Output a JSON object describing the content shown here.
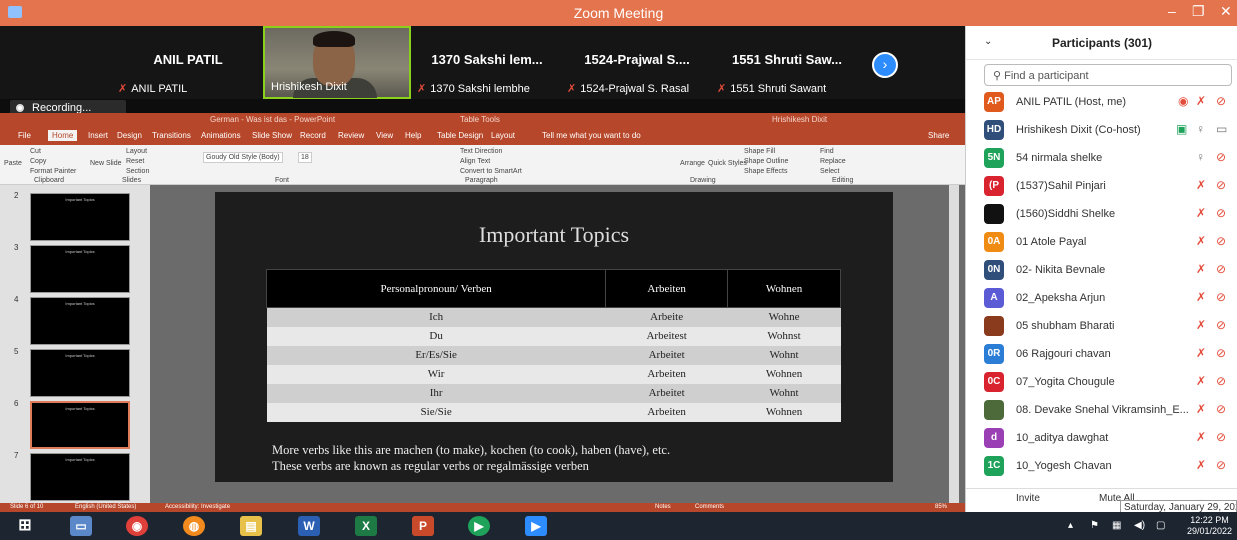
{
  "window": {
    "title": "Zoom Meeting",
    "minimize": "–",
    "maximize": "❐",
    "close": "✕"
  },
  "video_strip": [
    {
      "big": "ANIL PATIL",
      "small": "ANIL PATIL"
    },
    {
      "big": "",
      "small": "Hrishikesh Dixit"
    },
    {
      "big": "1370 Sakshi lem...",
      "small": "1370 Sakshi lembhe"
    },
    {
      "big": "1524-Prajwal S....",
      "small": "1524-Prajwal S. Rasal"
    },
    {
      "big": "1551 Shruti Saw...",
      "small": "1551 Shruti Sawant"
    }
  ],
  "recording": {
    "label": "Recording..."
  },
  "powerpoint": {
    "title": "German - Was ist das - PowerPoint",
    "table_tools": "Table Tools",
    "user": "Hrishikesh Dixit",
    "tabs": [
      "File",
      "Home",
      "Insert",
      "Design",
      "Transitions",
      "Animations",
      "Slide Show",
      "Record",
      "Review",
      "View",
      "Help",
      "Table Design",
      "Layout",
      "Tell me what you want to do",
      "Share"
    ],
    "ribbon": {
      "paste": "Paste",
      "cut": "Cut",
      "copy": "Copy",
      "format_painter": "Format Painter",
      "new_slide": "New Slide",
      "layout": "Layout",
      "reset": "Reset",
      "section": "Section",
      "font_name": "Goudy Old Style (Body)",
      "font_size": "18",
      "text_direction": "Text Direction",
      "align_text": "Align Text",
      "smartart": "Convert to SmartArt",
      "arrange": "Arrange",
      "quick_styles": "Quick Styles",
      "shape_fill": "Shape Fill",
      "shape_outline": "Shape Outline",
      "shape_effects": "Shape Effects",
      "find": "Find",
      "replace": "Replace",
      "select": "Select",
      "groups": [
        "Clipboard",
        "Slides",
        "Font",
        "Paragraph",
        "Drawing",
        "Editing"
      ]
    },
    "thumbnails": [
      {
        "num": "2",
        "title": "Important Topics"
      },
      {
        "num": "3",
        "title": "Important Topics"
      },
      {
        "num": "4",
        "title": "Important Topics"
      },
      {
        "num": "5",
        "title": "Important Topics"
      },
      {
        "num": "6",
        "title": "Important Topics"
      },
      {
        "num": "7",
        "title": "Important Topics"
      }
    ],
    "slide": {
      "title": "Important Topics",
      "headers": [
        "Personalpronoun/ Verben",
        "Arbeiten",
        "Wohnen"
      ],
      "rows": [
        [
          "Ich",
          "Arbeite",
          "Wohne"
        ],
        [
          "Du",
          "Arbeitest",
          "Wohnst"
        ],
        [
          "Er/Es/Sie",
          "Arbeitet",
          "Wohnt"
        ],
        [
          "Wir",
          "Arbeiten",
          "Wohnen"
        ],
        [
          "Ihr",
          "Arbeitet",
          "Wohnt"
        ],
        [
          "Sie/Sie",
          "Arbeiten",
          "Wohnen"
        ]
      ],
      "note_line1": "More verbs like this are machen (to make), kochen (to cook), haben (have), etc.",
      "note_line2": "These verbs are known as regular verbs or regalmässige verben"
    },
    "status": {
      "slide": "Slide 6 of 10",
      "language": "English (United States)",
      "accessibility": "Accessibility: Investigate",
      "notes": "Notes",
      "comments": "Comments",
      "zoom": "85%"
    }
  },
  "participants": {
    "header": "Participants (301)",
    "search_placeholder": "Find a participant",
    "list": [
      {
        "initials": "AP",
        "color": "#e05a1e",
        "name": "ANIL PATIL (Host, me)"
      },
      {
        "initials": "HD",
        "color": "#2f4e7a",
        "name": "Hrishikesh Dixit (Co-host)"
      },
      {
        "initials": "5N",
        "color": "#1fa25a",
        "name": "54 nirmala shelke"
      },
      {
        "initials": "(P",
        "color": "#d9232e",
        "name": "(1537)Sahil Pinjari"
      },
      {
        "initials": "",
        "color": "#111111",
        "name": "(1560)Siddhi Shelke"
      },
      {
        "initials": "0A",
        "color": "#f08c14",
        "name": "01 Atole Payal"
      },
      {
        "initials": "0N",
        "color": "#2f4e7a",
        "name": "02- Nikita Bevnale"
      },
      {
        "initials": "A",
        "color": "#5b5bd6",
        "name": "02_Apeksha Arjun"
      },
      {
        "initials": "",
        "color": "#8a3b1e",
        "name": "05 shubham Bharati"
      },
      {
        "initials": "0R",
        "color": "#2b7dd6",
        "name": "06 Rajgouri chavan"
      },
      {
        "initials": "0C",
        "color": "#d9232e",
        "name": "07_Yogita Chougule"
      },
      {
        "initials": "",
        "color": "#4d6b3a",
        "name": "08. Devake Snehal Vikramsinh_E..."
      },
      {
        "initials": "d",
        "color": "#9b3fb5",
        "name": "10_aditya dawghat"
      },
      {
        "initials": "1C",
        "color": "#1fa25a",
        "name": "10_Yogesh Chavan"
      }
    ],
    "invite": "Invite",
    "mute_all": "Mute All",
    "more": "...",
    "tooltip": "Saturday, January 29, 2022"
  },
  "taskbar": {
    "time": "12:22 PM",
    "date": "29/01/2022"
  }
}
